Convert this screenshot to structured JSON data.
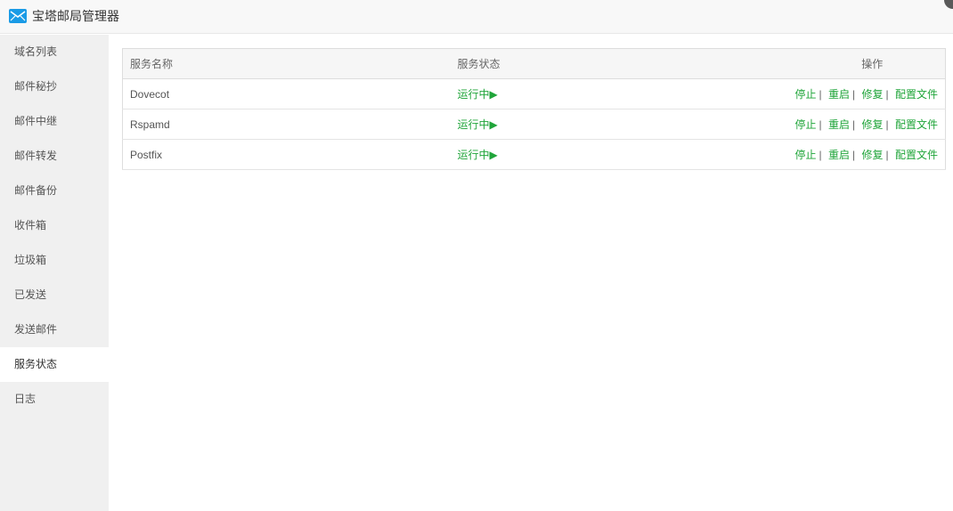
{
  "app": {
    "title": "宝塔邮局管理器",
    "icon": "mail-icon",
    "accent_color": "#20a53a"
  },
  "sidebar": {
    "items": [
      {
        "label": "域名列表"
      },
      {
        "label": "邮件秘抄"
      },
      {
        "label": "邮件中继"
      },
      {
        "label": "邮件转发"
      },
      {
        "label": "邮件备份"
      },
      {
        "label": "收件箱"
      },
      {
        "label": "垃圾箱"
      },
      {
        "label": "已发送"
      },
      {
        "label": "发送邮件"
      },
      {
        "label": "服务状态",
        "active": true
      },
      {
        "label": "日志"
      }
    ]
  },
  "table": {
    "headers": {
      "name": "服务名称",
      "status": "服务状态",
      "ops": "操作"
    },
    "rows": [
      {
        "name": "Dovecot",
        "status": "运行中▶",
        "ops": [
          "停止",
          "重启",
          "修复",
          "配置文件"
        ]
      },
      {
        "name": "Rspamd",
        "status": "运行中▶",
        "ops": [
          "停止",
          "重启",
          "修复",
          "配置文件"
        ]
      },
      {
        "name": "Postfix",
        "status": "运行中▶",
        "ops": [
          "停止",
          "重启",
          "修复",
          "配置文件"
        ]
      }
    ],
    "separator": "|"
  }
}
